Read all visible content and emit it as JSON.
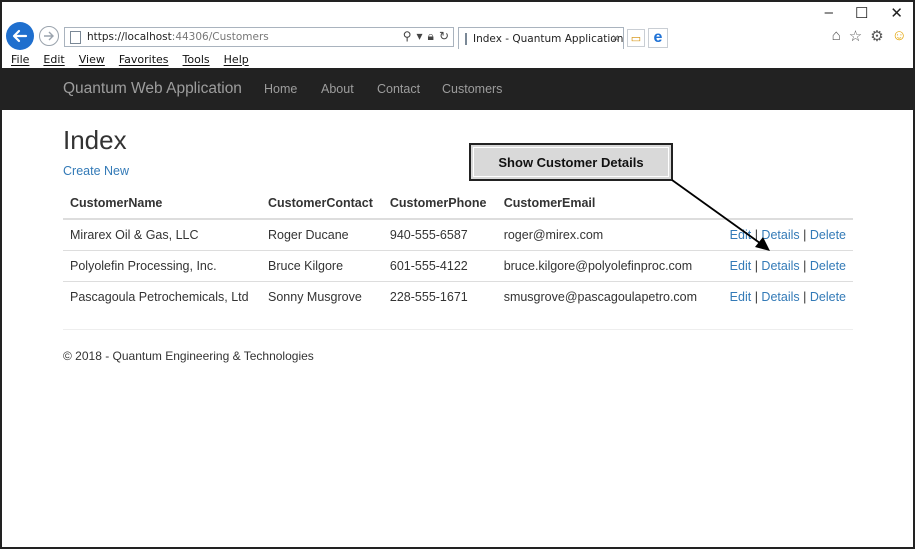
{
  "browser": {
    "url_main": "https://localhost",
    "url_rest": ":44306/Customers",
    "tab_title": "Index - Quantum Application",
    "tab_close": "×",
    "window_controls": [
      "–",
      "☐",
      "✕"
    ],
    "menu": [
      "File",
      "Edit",
      "View",
      "Favorites",
      "Tools",
      "Help"
    ]
  },
  "navbar": {
    "brand": "Quantum Web Application",
    "links": [
      "Home",
      "About",
      "Contact",
      "Customers"
    ]
  },
  "page": {
    "title": "Index",
    "create_new": "Create New",
    "footer": "© 2018 - Quantum Engineering & Technologies"
  },
  "table": {
    "headers": [
      "CustomerName",
      "CustomerContact",
      "CustomerPhone",
      "CustomerEmail"
    ],
    "rows": [
      {
        "name": "Mirarex Oil & Gas, LLC",
        "contact": "Roger Ducane",
        "phone": "940-555-6587",
        "email": "roger@mirex.com"
      },
      {
        "name": "Polyolefin Processing, Inc.",
        "contact": "Bruce Kilgore",
        "phone": "601-555-4122",
        "email": "bruce.kilgore@polyolefinproc.com"
      },
      {
        "name": "Pascagoula Petrochemicals, Ltd",
        "contact": "Sonny Musgrove",
        "phone": "228-555-1671",
        "email": "smusgrove@pascagoulapetro.com"
      }
    ],
    "actions": {
      "edit": "Edit",
      "details": "Details",
      "delete": "Delete",
      "sep": "|"
    }
  },
  "callout": {
    "text": "Show Customer Details"
  },
  "colors": {
    "navbar_bg": "#222222",
    "nav_text": "#9d9d9d",
    "link": "#337ab7",
    "callout_bg": "#d9d9d9"
  },
  "icons": [
    "back-arrow-icon",
    "forward-arrow-icon",
    "page-icon",
    "search-icon",
    "dropdown-icon",
    "lock-icon",
    "refresh-icon",
    "new-tab-icon",
    "ie-logo-icon",
    "home-icon",
    "favorites-star-icon",
    "settings-gear-icon",
    "smiley-feedback-icon"
  ]
}
